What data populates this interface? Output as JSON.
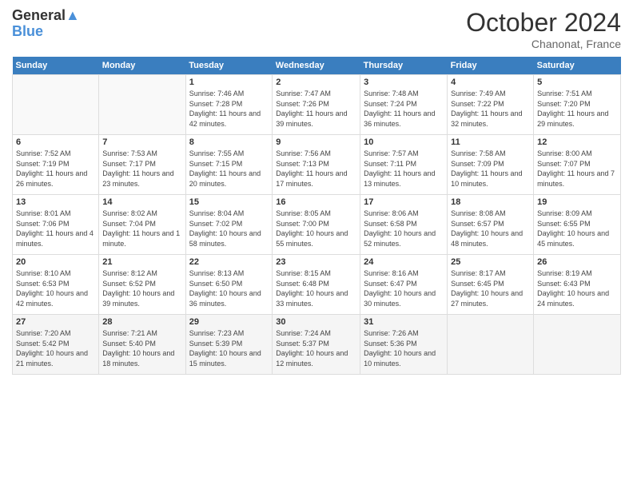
{
  "header": {
    "logo_line1": "General",
    "logo_line2": "Blue",
    "month": "October 2024",
    "location": "Chanonat, France"
  },
  "days_of_week": [
    "Sunday",
    "Monday",
    "Tuesday",
    "Wednesday",
    "Thursday",
    "Friday",
    "Saturday"
  ],
  "weeks": [
    [
      {
        "day": "",
        "info": ""
      },
      {
        "day": "",
        "info": ""
      },
      {
        "day": "1",
        "info": "Sunrise: 7:46 AM\nSunset: 7:28 PM\nDaylight: 11 hours and 42 minutes."
      },
      {
        "day": "2",
        "info": "Sunrise: 7:47 AM\nSunset: 7:26 PM\nDaylight: 11 hours and 39 minutes."
      },
      {
        "day": "3",
        "info": "Sunrise: 7:48 AM\nSunset: 7:24 PM\nDaylight: 11 hours and 36 minutes."
      },
      {
        "day": "4",
        "info": "Sunrise: 7:49 AM\nSunset: 7:22 PM\nDaylight: 11 hours and 32 minutes."
      },
      {
        "day": "5",
        "info": "Sunrise: 7:51 AM\nSunset: 7:20 PM\nDaylight: 11 hours and 29 minutes."
      }
    ],
    [
      {
        "day": "6",
        "info": "Sunrise: 7:52 AM\nSunset: 7:19 PM\nDaylight: 11 hours and 26 minutes."
      },
      {
        "day": "7",
        "info": "Sunrise: 7:53 AM\nSunset: 7:17 PM\nDaylight: 11 hours and 23 minutes."
      },
      {
        "day": "8",
        "info": "Sunrise: 7:55 AM\nSunset: 7:15 PM\nDaylight: 11 hours and 20 minutes."
      },
      {
        "day": "9",
        "info": "Sunrise: 7:56 AM\nSunset: 7:13 PM\nDaylight: 11 hours and 17 minutes."
      },
      {
        "day": "10",
        "info": "Sunrise: 7:57 AM\nSunset: 7:11 PM\nDaylight: 11 hours and 13 minutes."
      },
      {
        "day": "11",
        "info": "Sunrise: 7:58 AM\nSunset: 7:09 PM\nDaylight: 11 hours and 10 minutes."
      },
      {
        "day": "12",
        "info": "Sunrise: 8:00 AM\nSunset: 7:07 PM\nDaylight: 11 hours and 7 minutes."
      }
    ],
    [
      {
        "day": "13",
        "info": "Sunrise: 8:01 AM\nSunset: 7:06 PM\nDaylight: 11 hours and 4 minutes."
      },
      {
        "day": "14",
        "info": "Sunrise: 8:02 AM\nSunset: 7:04 PM\nDaylight: 11 hours and 1 minute."
      },
      {
        "day": "15",
        "info": "Sunrise: 8:04 AM\nSunset: 7:02 PM\nDaylight: 10 hours and 58 minutes."
      },
      {
        "day": "16",
        "info": "Sunrise: 8:05 AM\nSunset: 7:00 PM\nDaylight: 10 hours and 55 minutes."
      },
      {
        "day": "17",
        "info": "Sunrise: 8:06 AM\nSunset: 6:58 PM\nDaylight: 10 hours and 52 minutes."
      },
      {
        "day": "18",
        "info": "Sunrise: 8:08 AM\nSunset: 6:57 PM\nDaylight: 10 hours and 48 minutes."
      },
      {
        "day": "19",
        "info": "Sunrise: 8:09 AM\nSunset: 6:55 PM\nDaylight: 10 hours and 45 minutes."
      }
    ],
    [
      {
        "day": "20",
        "info": "Sunrise: 8:10 AM\nSunset: 6:53 PM\nDaylight: 10 hours and 42 minutes."
      },
      {
        "day": "21",
        "info": "Sunrise: 8:12 AM\nSunset: 6:52 PM\nDaylight: 10 hours and 39 minutes."
      },
      {
        "day": "22",
        "info": "Sunrise: 8:13 AM\nSunset: 6:50 PM\nDaylight: 10 hours and 36 minutes."
      },
      {
        "day": "23",
        "info": "Sunrise: 8:15 AM\nSunset: 6:48 PM\nDaylight: 10 hours and 33 minutes."
      },
      {
        "day": "24",
        "info": "Sunrise: 8:16 AM\nSunset: 6:47 PM\nDaylight: 10 hours and 30 minutes."
      },
      {
        "day": "25",
        "info": "Sunrise: 8:17 AM\nSunset: 6:45 PM\nDaylight: 10 hours and 27 minutes."
      },
      {
        "day": "26",
        "info": "Sunrise: 8:19 AM\nSunset: 6:43 PM\nDaylight: 10 hours and 24 minutes."
      }
    ],
    [
      {
        "day": "27",
        "info": "Sunrise: 7:20 AM\nSunset: 5:42 PM\nDaylight: 10 hours and 21 minutes."
      },
      {
        "day": "28",
        "info": "Sunrise: 7:21 AM\nSunset: 5:40 PM\nDaylight: 10 hours and 18 minutes."
      },
      {
        "day": "29",
        "info": "Sunrise: 7:23 AM\nSunset: 5:39 PM\nDaylight: 10 hours and 15 minutes."
      },
      {
        "day": "30",
        "info": "Sunrise: 7:24 AM\nSunset: 5:37 PM\nDaylight: 10 hours and 12 minutes."
      },
      {
        "day": "31",
        "info": "Sunrise: 7:26 AM\nSunset: 5:36 PM\nDaylight: 10 hours and 10 minutes."
      },
      {
        "day": "",
        "info": ""
      },
      {
        "day": "",
        "info": ""
      }
    ]
  ]
}
